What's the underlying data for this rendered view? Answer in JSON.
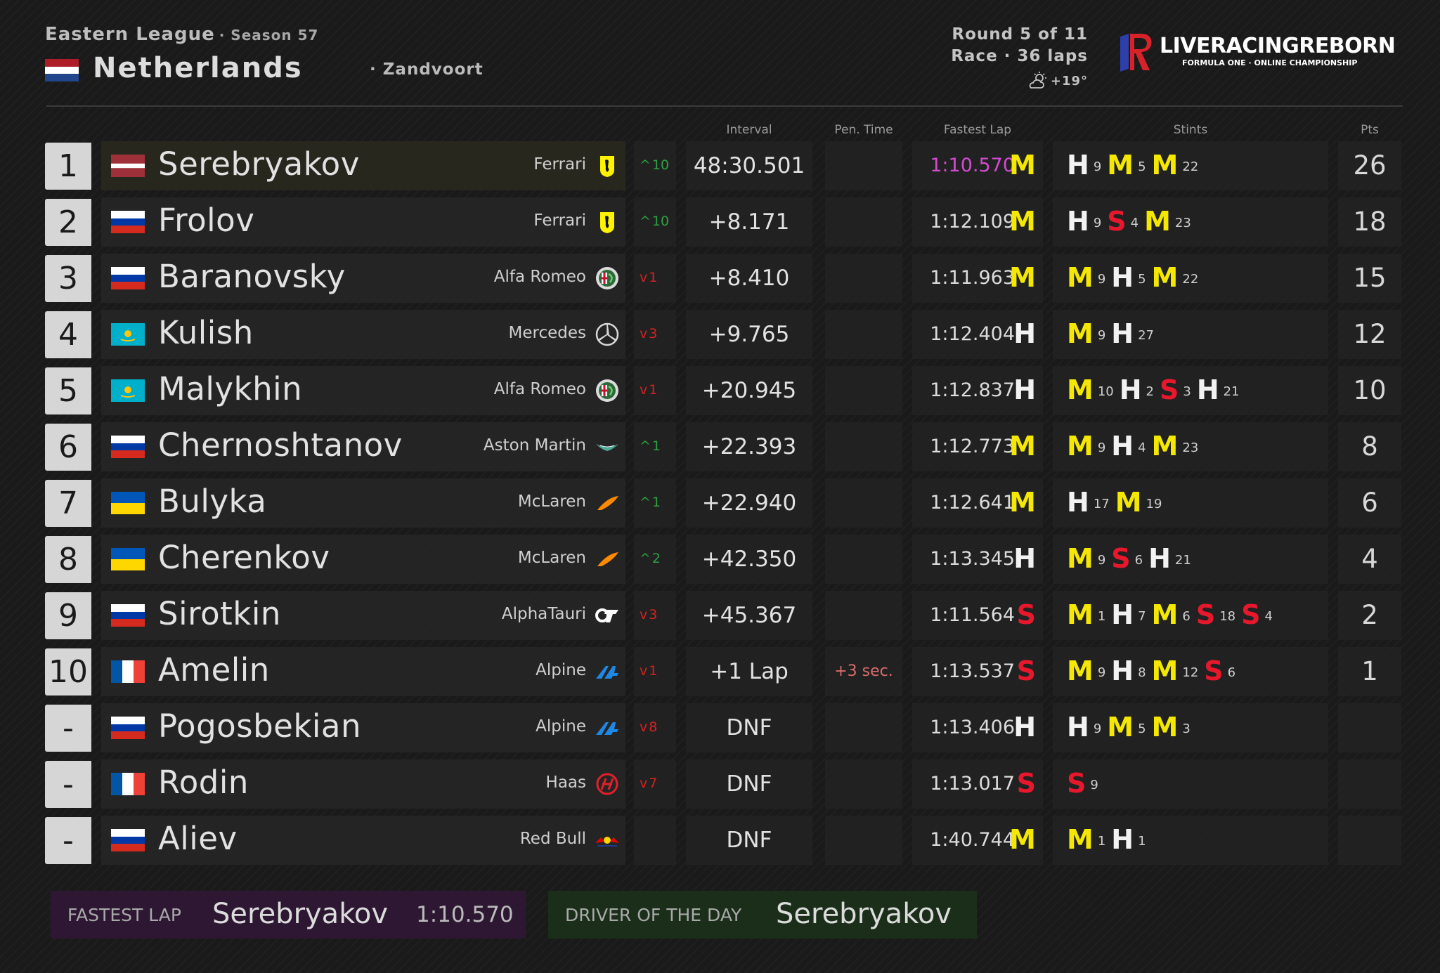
{
  "header": {
    "league": "Eastern League",
    "season": "· Season 57",
    "country": "Netherlands",
    "circuit": "· Zandvoort",
    "round": "Round 5 of 11",
    "race": "Race · 36 laps",
    "weather": "+19°",
    "brand": "LIVERACINGREBORN",
    "brand_sub": "FORMULA ONE · ONLINE CHAMPIONSHIP"
  },
  "columns": {
    "interval": "Interval",
    "pen": "Pen. Time",
    "fastest": "Fastest Lap",
    "stints": "Stints",
    "pts": "Pts"
  },
  "rows": [
    {
      "pos": "1",
      "flag": "latvia",
      "name": "Serebryakov",
      "team": "Ferrari",
      "team_icon": "ferrari",
      "chg_dir": "up",
      "chg": "10",
      "interval": "48:30.501",
      "pen": "",
      "fl": "1:10.570",
      "fl_tyre": "M",
      "fl_best": true,
      "stints": [
        [
          "H",
          "9"
        ],
        [
          "M",
          "5"
        ],
        [
          "M",
          "22"
        ]
      ],
      "pts": "26"
    },
    {
      "pos": "2",
      "flag": "russia",
      "name": "Frolov",
      "team": "Ferrari",
      "team_icon": "ferrari",
      "chg_dir": "up",
      "chg": "10",
      "interval": "+8.171",
      "pen": "",
      "fl": "1:12.109",
      "fl_tyre": "M",
      "stints": [
        [
          "H",
          "9"
        ],
        [
          "S",
          "4"
        ],
        [
          "M",
          "23"
        ]
      ],
      "pts": "18"
    },
    {
      "pos": "3",
      "flag": "russia",
      "name": "Baranovsky",
      "team": "Alfa Romeo",
      "team_icon": "alfa",
      "chg_dir": "dn",
      "chg": "1",
      "interval": "+8.410",
      "pen": "",
      "fl": "1:11.963",
      "fl_tyre": "M",
      "stints": [
        [
          "M",
          "9"
        ],
        [
          "H",
          "5"
        ],
        [
          "M",
          "22"
        ]
      ],
      "pts": "15"
    },
    {
      "pos": "4",
      "flag": "kazakhstan",
      "name": "Kulish",
      "team": "Mercedes",
      "team_icon": "mercedes",
      "chg_dir": "dn",
      "chg": "3",
      "interval": "+9.765",
      "pen": "",
      "fl": "1:12.404",
      "fl_tyre": "H",
      "stints": [
        [
          "M",
          "9"
        ],
        [
          "H",
          "27"
        ]
      ],
      "pts": "12"
    },
    {
      "pos": "5",
      "flag": "kazakhstan",
      "name": "Malykhin",
      "team": "Alfa Romeo",
      "team_icon": "alfa",
      "chg_dir": "dn",
      "chg": "1",
      "interval": "+20.945",
      "pen": "",
      "fl": "1:12.837",
      "fl_tyre": "H",
      "stints": [
        [
          "M",
          "10"
        ],
        [
          "H",
          "2"
        ],
        [
          "S",
          "3"
        ],
        [
          "H",
          "21"
        ]
      ],
      "pts": "10"
    },
    {
      "pos": "6",
      "flag": "russia",
      "name": "Chernoshtanov",
      "team": "Aston Martin",
      "team_icon": "aston",
      "chg_dir": "up",
      "chg": "1",
      "interval": "+22.393",
      "pen": "",
      "fl": "1:12.773",
      "fl_tyre": "M",
      "stints": [
        [
          "M",
          "9"
        ],
        [
          "H",
          "4"
        ],
        [
          "M",
          "23"
        ]
      ],
      "pts": "8"
    },
    {
      "pos": "7",
      "flag": "ukraine",
      "name": "Bulyka",
      "team": "McLaren",
      "team_icon": "mclaren",
      "chg_dir": "up",
      "chg": "1",
      "interval": "+22.940",
      "pen": "",
      "fl": "1:12.641",
      "fl_tyre": "M",
      "stints": [
        [
          "H",
          "17"
        ],
        [
          "M",
          "19"
        ]
      ],
      "pts": "6"
    },
    {
      "pos": "8",
      "flag": "ukraine",
      "name": "Cherenkov",
      "team": "McLaren",
      "team_icon": "mclaren",
      "chg_dir": "up",
      "chg": "2",
      "interval": "+42.350",
      "pen": "",
      "fl": "1:13.345",
      "fl_tyre": "H",
      "stints": [
        [
          "M",
          "9"
        ],
        [
          "S",
          "6"
        ],
        [
          "H",
          "21"
        ]
      ],
      "pts": "4"
    },
    {
      "pos": "9",
      "flag": "russia",
      "name": "Sirotkin",
      "team": "AlphaTauri",
      "team_icon": "alphatauri",
      "chg_dir": "dn",
      "chg": "3",
      "interval": "+45.367",
      "pen": "",
      "fl": "1:11.564",
      "fl_tyre": "S",
      "stints": [
        [
          "M",
          "1"
        ],
        [
          "H",
          "7"
        ],
        [
          "M",
          "6"
        ],
        [
          "S",
          "18"
        ],
        [
          "S",
          "4"
        ]
      ],
      "pts": "2"
    },
    {
      "pos": "10",
      "flag": "france",
      "name": "Amelin",
      "team": "Alpine",
      "team_icon": "alpine",
      "chg_dir": "dn",
      "chg": "1",
      "interval": "+1 Lap",
      "pen": "+3 sec.",
      "fl": "1:13.537",
      "fl_tyre": "S",
      "stints": [
        [
          "M",
          "9"
        ],
        [
          "H",
          "8"
        ],
        [
          "M",
          "12"
        ],
        [
          "S",
          "6"
        ]
      ],
      "pts": "1"
    },
    {
      "pos": "-",
      "flag": "russia",
      "name": "Pogosbekian",
      "team": "Alpine",
      "team_icon": "alpine",
      "chg_dir": "dn",
      "chg": "8",
      "interval": "DNF",
      "pen": "",
      "fl": "1:13.406",
      "fl_tyre": "H",
      "stints": [
        [
          "H",
          "9"
        ],
        [
          "M",
          "5"
        ],
        [
          "M",
          "3"
        ]
      ],
      "pts": ""
    },
    {
      "pos": "-",
      "flag": "france",
      "name": "Rodin",
      "team": "Haas",
      "team_icon": "haas",
      "chg_dir": "dn",
      "chg": "7",
      "interval": "DNF",
      "pen": "",
      "fl": "1:13.017",
      "fl_tyre": "S",
      "stints": [
        [
          "S",
          "9"
        ]
      ],
      "pts": ""
    },
    {
      "pos": "-",
      "flag": "russia",
      "name": "Aliev",
      "team": "Red Bull",
      "team_icon": "redbull",
      "chg_dir": "",
      "chg": "",
      "interval": "DNF",
      "pen": "",
      "fl": "1:40.744",
      "fl_tyre": "M",
      "stints": [
        [
          "M",
          "1"
        ],
        [
          "H",
          "1"
        ]
      ],
      "pts": ""
    }
  ],
  "fastest_lap": {
    "label": "FASTEST LAP",
    "driver": "Serebryakov",
    "time": "1:10.570"
  },
  "driver_of_day": {
    "label": "DRIVER OF THE DAY",
    "driver": "Serebryakov"
  },
  "colors": {
    "soft": "#e8182c",
    "medium": "#f5e800",
    "hard": "#f2f2f2",
    "gain": "#2ea043",
    "loss": "#d42222",
    "fastest": "#d44bd4"
  }
}
